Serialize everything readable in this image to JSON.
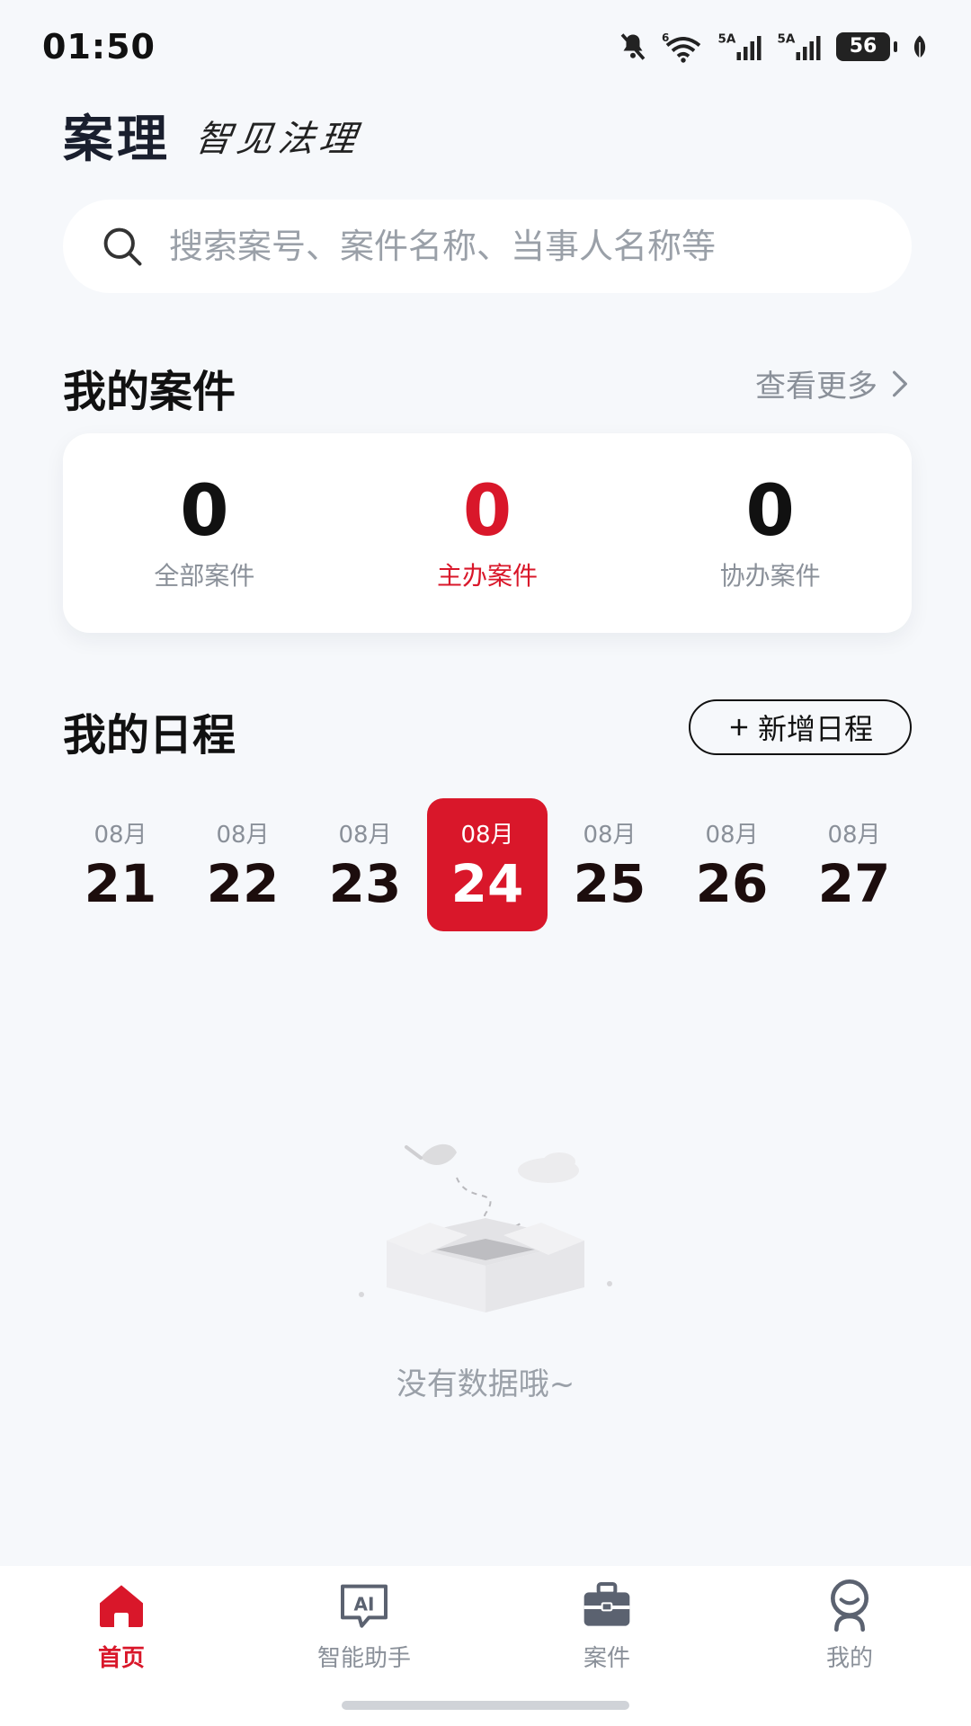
{
  "status_bar": {
    "time": "01:50",
    "network_1": "6",
    "network_2": "5A",
    "network_3": "5A",
    "battery": "56",
    "icons": [
      "mute-bell-icon",
      "wifi-icon",
      "signal-icon",
      "signal-icon",
      "battery-icon",
      "leaf-icon"
    ]
  },
  "brand": {
    "title": "案理",
    "slogan": "智见法理"
  },
  "search": {
    "placeholder": "搜索案号、案件名称、当事人名称等"
  },
  "cases": {
    "title": "我的案件",
    "view_more": "查看更多",
    "stats": [
      {
        "value": "0",
        "label": "全部案件"
      },
      {
        "value": "0",
        "label": "主办案件"
      },
      {
        "value": "0",
        "label": "协办案件"
      }
    ]
  },
  "schedule": {
    "title": "我的日程",
    "add_label": "新增日程",
    "dates": [
      {
        "month": "08月",
        "day": "21"
      },
      {
        "month": "08月",
        "day": "22"
      },
      {
        "month": "08月",
        "day": "23"
      },
      {
        "month": "08月",
        "day": "24"
      },
      {
        "month": "08月",
        "day": "25"
      },
      {
        "month": "08月",
        "day": "26"
      },
      {
        "month": "08月",
        "day": "27"
      }
    ],
    "selected_index": 3,
    "empty_text": "没有数据哦~"
  },
  "bottom_nav": [
    {
      "label": "首页",
      "icon": "home-icon",
      "active": true
    },
    {
      "label": "智能助手",
      "icon": "ai-assistant-icon",
      "active": false
    },
    {
      "label": "案件",
      "icon": "briefcase-icon",
      "active": false
    },
    {
      "label": "我的",
      "icon": "profile-icon",
      "active": false
    }
  ],
  "colors": {
    "accent": "#d9172a",
    "background": "#f6f8fb",
    "muted_text": "#8a9099"
  }
}
